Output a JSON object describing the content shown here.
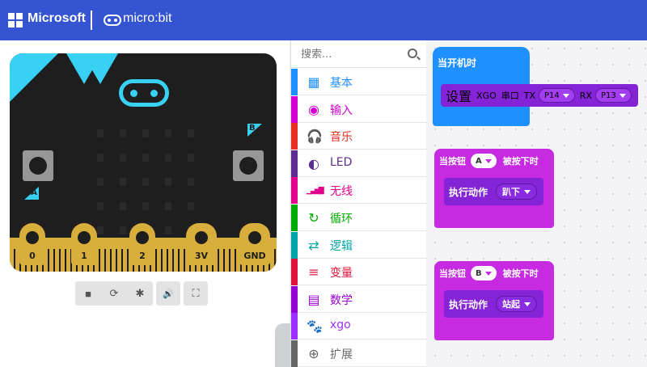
{
  "header": {
    "brand": "Microsoft",
    "product": "micro:bit",
    "bg_color": "#3454d1"
  },
  "simulator": {
    "pins": [
      "0",
      "1",
      "2",
      "3V",
      "GND"
    ],
    "button_a": "A",
    "button_b": "B",
    "toolbar": [
      {
        "name": "stop",
        "icon": "■"
      },
      {
        "name": "restart",
        "icon": "⟳"
      },
      {
        "name": "debug",
        "icon": "✱"
      },
      {
        "name": "mute",
        "icon": "🔊"
      },
      {
        "name": "fullscreen",
        "icon": "⛶"
      }
    ]
  },
  "toolbox": {
    "search_placeholder": "搜索...",
    "categories": [
      {
        "label": "基本",
        "color": "#1e90ff",
        "icon": "grid-icon",
        "glyph": "▦"
      },
      {
        "label": "输入",
        "color": "#d400d4",
        "icon": "target-icon",
        "glyph": "◉"
      },
      {
        "label": "音乐",
        "color": "#e63022",
        "icon": "headphones-icon",
        "glyph": "🎧"
      },
      {
        "label": "LED",
        "color": "#5c2d91",
        "icon": "toggle-icon",
        "glyph": "◐"
      },
      {
        "label": "无线",
        "color": "#e3008c",
        "icon": "signal-icon",
        "glyph": "▁▃▅▇"
      },
      {
        "label": "循环",
        "color": "#00aa00",
        "icon": "loop-icon",
        "glyph": "↻"
      },
      {
        "label": "逻辑",
        "color": "#00a4a6",
        "icon": "shuffle-icon",
        "glyph": "⇄"
      },
      {
        "label": "变量",
        "color": "#dc143c",
        "icon": "list-icon",
        "glyph": "≡"
      },
      {
        "label": "数学",
        "color": "#9400d3",
        "icon": "calculator-icon",
        "glyph": "▤"
      },
      {
        "label": "xgo",
        "color": "#9b30ff",
        "icon": "paw-icon",
        "glyph": "🐾"
      },
      {
        "label": "扩展",
        "color": "#666666",
        "icon": "plus-circle-icon",
        "glyph": "⊕"
      }
    ]
  },
  "workspace": {
    "start_block": {
      "label": "当开机时",
      "inner": {
        "text1": "设置",
        "text2": "XGO",
        "text3": "串口",
        "text4": "TX",
        "tx_pin": "P14",
        "text5": "RX",
        "rx_pin": "P13"
      }
    },
    "event_blocks": [
      {
        "prefix": "当按钮",
        "button": "A",
        "suffix": "被按下时",
        "action_label": "执行动作",
        "action": "趴下"
      },
      {
        "prefix": "当按钮",
        "button": "B",
        "suffix": "被按下时",
        "action_label": "执行动作",
        "action": "站起"
      }
    ]
  }
}
